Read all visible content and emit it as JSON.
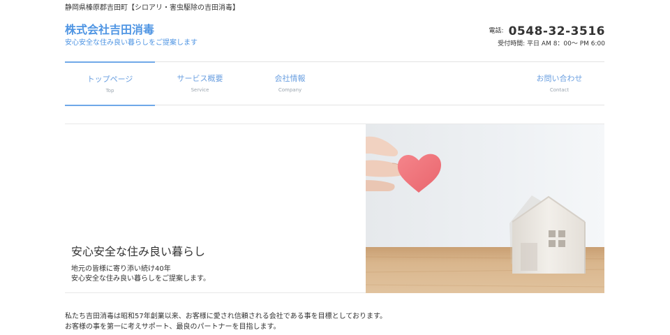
{
  "header": {
    "tagline": "静岡県榛原郡吉田町【シロアリ・害虫駆除の吉田消毒】",
    "company_name": "株式会社吉田消毒",
    "company_sub": "安心安全な住み良い暮らしをご提案します",
    "phone_label": "電話:",
    "phone_number": "0548-32-3516",
    "hours": "受付時間: 平日 AM 8：00～ PM 6:00"
  },
  "nav": {
    "items": [
      {
        "label": "トップページ",
        "sub": "Top"
      },
      {
        "label": "サービス概要",
        "sub": "Service"
      },
      {
        "label": "会社情報",
        "sub": "Company"
      },
      {
        "label": "お問い合わせ",
        "sub": "Contact"
      }
    ],
    "active_index": 0
  },
  "hero": {
    "title": "安心安全な住み良い暮らし",
    "line1": "地元の皆様に寄り添い続け40年",
    "line2": "安心安全な住み良い暮らしをご提案します。"
  },
  "intro": {
    "line1": "私たち吉田消毒は昭和57年創業以来、お客様に愛され信頼される会社である事を目標としております。",
    "line2": "お客様の事を第一に考えサポート、最良のパートナーを目指します。"
  },
  "colors": {
    "accent": "#4f95e3",
    "nav_active": "#6fa8e8",
    "heart": "#f0737a",
    "wood": "#cda377"
  }
}
